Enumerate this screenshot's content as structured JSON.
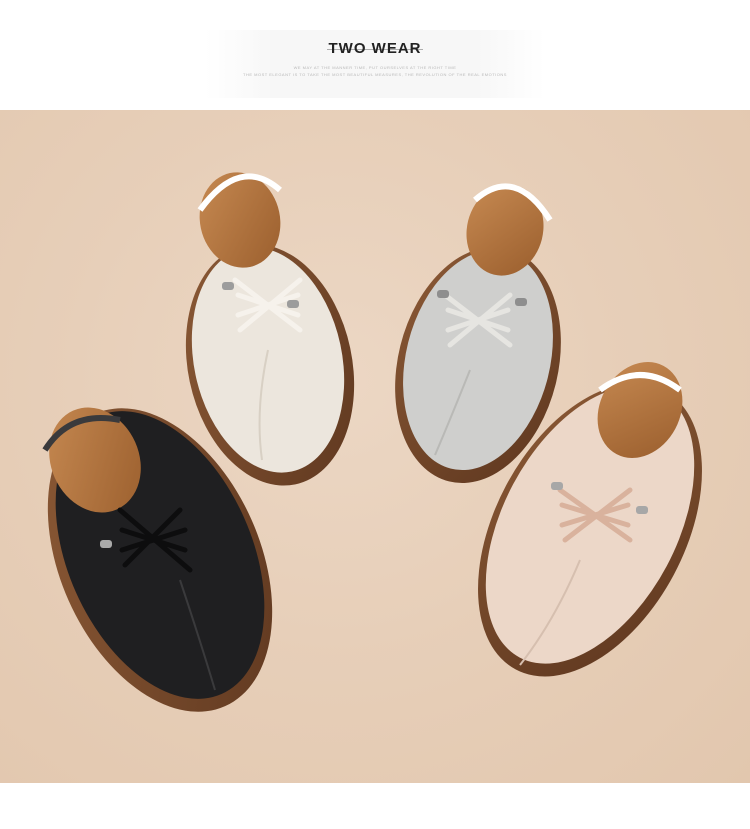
{
  "header": {
    "title": "TWO WEAR",
    "subtitle_line1": "we may at the manner time, put ourselves at the right time",
    "subtitle_line2": "the most elegant is to take the most beautiful measures, the revolution of the real emotions"
  },
  "photo": {
    "shoes": [
      {
        "color_name": "cream",
        "upper": "#ece6dd",
        "lace": "#f1ece4"
      },
      {
        "color_name": "grey",
        "upper": "#cfcfcd",
        "lace": "#e3e2de"
      },
      {
        "color_name": "black",
        "upper": "#1f1f21",
        "lace": "#111112"
      },
      {
        "color_name": "pink",
        "upper": "#ecd7c8",
        "lace": "#e8c7b5"
      }
    ],
    "colors": {
      "background": "#e7cfb9",
      "sole": "#7a4a2c",
      "lining": "#b5773f"
    }
  }
}
